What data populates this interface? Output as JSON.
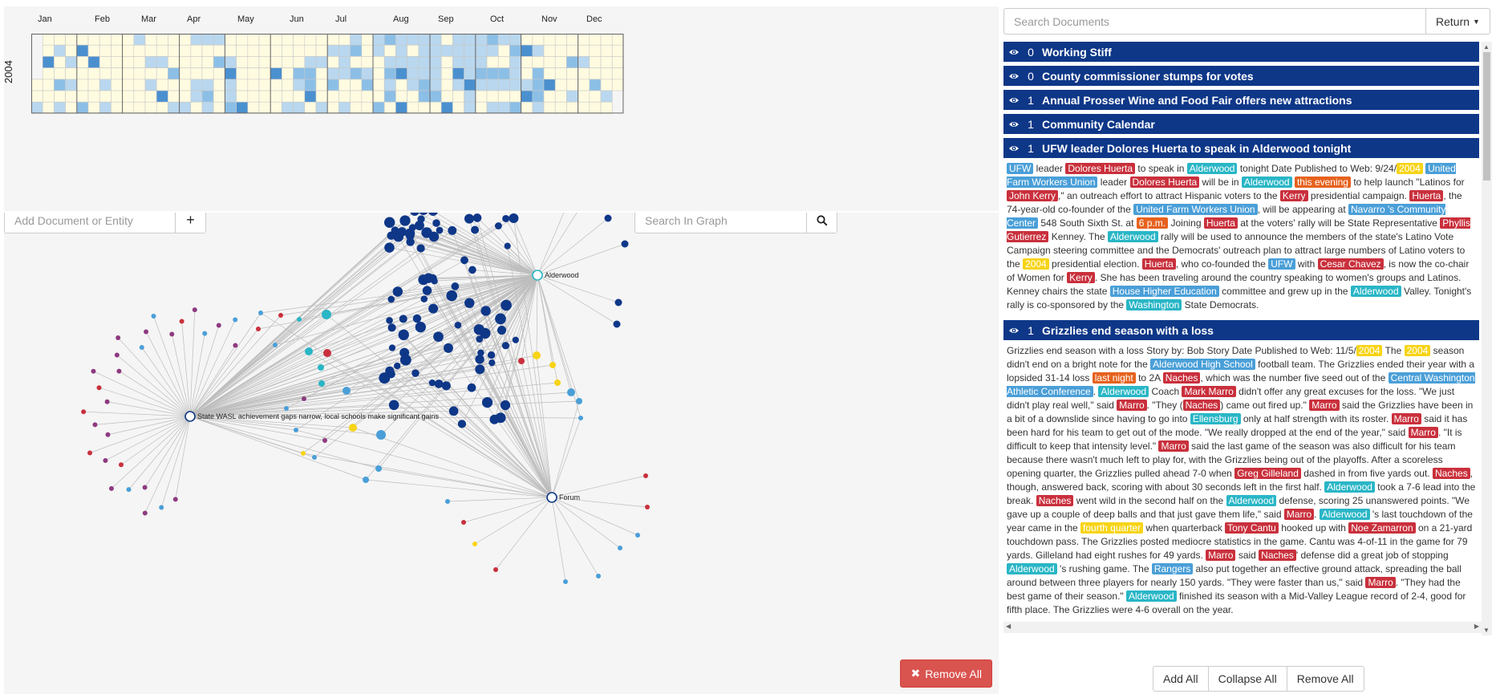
{
  "calendar": {
    "year": "2004",
    "months": [
      "Jan",
      "Feb",
      "Mar",
      "Apr",
      "May",
      "Jun",
      "Jul",
      "Aug",
      "Sep",
      "Oct",
      "Nov",
      "Dec"
    ],
    "colors": {
      "empty": "#fffbe0",
      "light": "#b9d7ee",
      "mid": "#8cbfe6",
      "dark": "#4a90cf"
    }
  },
  "graph": {
    "add_placeholder": "Add Document or Entity",
    "search_placeholder": "Search In Graph",
    "remove_all_label": "Remove All",
    "hub_labels": {
      "alderwood": "Alderwood",
      "forum": "Forum",
      "wasl": "State WASL achievement gaps narrow, local schools make significant gains"
    },
    "colors": {
      "document": "#0e3788",
      "org": "#4a9fd8",
      "per": "#c9303c",
      "loc": "#29b6c6",
      "date": "#f7d417",
      "time": "#e6621e",
      "misc": "#8e3a80",
      "edge": "#bdbdbd"
    }
  },
  "docs": {
    "search_placeholder": "Search Documents",
    "return_label": "Return",
    "items": [
      {
        "count": "0",
        "title": "Working Stiff"
      },
      {
        "count": "0",
        "title": "County commissioner stumps for votes"
      },
      {
        "count": "1",
        "title": "Annual Prosser Wine and Food Fair offers new attractions"
      },
      {
        "count": "1",
        "title": "Community Calendar"
      },
      {
        "count": "1",
        "title": "UFW leader Dolores Huerta to speak in Alderwood tonight"
      },
      {
        "count": "1",
        "title": "Grizzlies end season with a loss"
      }
    ],
    "doc5_body": [
      [
        "org",
        "UFW"
      ],
      [
        "t",
        " leader "
      ],
      [
        "per",
        "Dolores Huerta"
      ],
      [
        "t",
        " to speak in "
      ],
      [
        "loc",
        "Alderwood"
      ],
      [
        "t",
        " tonight Date Published to Web: 9/24/"
      ],
      [
        "date",
        "2004"
      ],
      [
        "t",
        " "
      ],
      [
        "org",
        "United Farm Workers Union"
      ],
      [
        "t",
        " leader "
      ],
      [
        "per",
        "Dolores Huerta"
      ],
      [
        "t",
        " will be in "
      ],
      [
        "loc",
        "Alderwood"
      ],
      [
        "t",
        " "
      ],
      [
        "time",
        "this evening"
      ],
      [
        "t",
        " to help launch \"Latinos for "
      ],
      [
        "per",
        "John Kerry"
      ],
      [
        "t",
        ",\" an outreach effort to attract Hispanic voters to the "
      ],
      [
        "per",
        "Kerry"
      ],
      [
        "t",
        " presidential campaign. "
      ],
      [
        "per",
        "Huerta"
      ],
      [
        "t",
        ", the 74-year-old co-founder of the "
      ],
      [
        "org",
        "United Farm Workers Union"
      ],
      [
        "t",
        ", will be appearing at "
      ],
      [
        "org",
        "Navarro 's Community Center"
      ],
      [
        "t",
        " 548 South Sixth St. at "
      ],
      [
        "time",
        "6 p.m."
      ],
      [
        "t",
        " Joining "
      ],
      [
        "per",
        "Huerta"
      ],
      [
        "t",
        " at the voters' rally will be State Representative "
      ],
      [
        "per",
        "Phyllis Gutierrez"
      ],
      [
        "t",
        " Kenney. The "
      ],
      [
        "loc",
        "Alderwood"
      ],
      [
        "t",
        " rally will be used to announce the members of the state's Latino Vote Campaign steering committee and the Democrats' outreach plan to attract large numbers of Latino voters to the "
      ],
      [
        "date",
        "2004"
      ],
      [
        "t",
        " presidential election. "
      ],
      [
        "per",
        "Huerta"
      ],
      [
        "t",
        ", who co-founded the "
      ],
      [
        "org",
        "UFW"
      ],
      [
        "t",
        " with "
      ],
      [
        "per",
        "Cesar Chavez"
      ],
      [
        "t",
        ", is now the co-chair of Women for "
      ],
      [
        "per",
        "Kerry"
      ],
      [
        "t",
        ". She has been traveling around the country speaking to women's groups and Latinos. Kenney chairs the state "
      ],
      [
        "org",
        "House Higher Education"
      ],
      [
        "t",
        " committee and grew up in the "
      ],
      [
        "loc",
        "Alderwood"
      ],
      [
        "t",
        " Valley. Tonight's rally is co-sponsored by the "
      ],
      [
        "loc",
        "Washington"
      ],
      [
        "t",
        " State Democrats."
      ]
    ],
    "doc6_body": [
      [
        "t",
        "Grizzlies end season with a loss Story by: Bob Story Date Published to Web: 11/5/"
      ],
      [
        "date",
        "2004"
      ],
      [
        "t",
        " The "
      ],
      [
        "date",
        "2004"
      ],
      [
        "t",
        " season didn't end on a bright note for the "
      ],
      [
        "org",
        "Alderwood High School"
      ],
      [
        "t",
        " football team.   The Grizzlies ended their year with a lopsided 31-14 loss "
      ],
      [
        "time",
        "last night"
      ],
      [
        "t",
        " to 2A "
      ],
      [
        "per",
        "Naches"
      ],
      [
        "t",
        ", which was the number five seed out of the "
      ],
      [
        "org",
        "Central Washington Athletic Conference"
      ],
      [
        "t",
        ".   "
      ],
      [
        "loc",
        "Alderwood"
      ],
      [
        "t",
        " Coach "
      ],
      [
        "per",
        "Mark Marro"
      ],
      [
        "t",
        " didn't offer any great excuses for the loss.   \"We just didn't play real well,\" said "
      ],
      [
        "per",
        "Marro"
      ],
      [
        "t",
        ". \"They ("
      ],
      [
        "per",
        "Naches"
      ],
      [
        "t",
        ") came out fired up.\"   "
      ],
      [
        "per",
        "Marro"
      ],
      [
        "t",
        " said the Grizzlies have been in a bit of a downslide since having to go into "
      ],
      [
        "loc",
        "Ellensburg"
      ],
      [
        "t",
        " only at half strength with its roster. "
      ],
      [
        "per",
        "Marro"
      ],
      [
        "t",
        " said it has been hard for his team to get out of the mode.   \"We really dropped at the end of the year,\" said "
      ],
      [
        "per",
        "Marro"
      ],
      [
        "t",
        ". \"It is difficult to keep that intensity level.\"   "
      ],
      [
        "per",
        "Marro"
      ],
      [
        "t",
        " said the last game of the season was also difficult for his team because there wasn't much left to play for, with the Grizzlies being out of the playoffs.   After a scoreless opening quarter, the Grizzlies pulled ahead 7-0 when "
      ],
      [
        "per",
        "Greg Gilleland"
      ],
      [
        "t",
        " dashed in from five yards out. "
      ],
      [
        "per",
        "Naches"
      ],
      [
        "t",
        ", though, answered back, scoring with about 30 seconds left in the first half. "
      ],
      [
        "loc",
        "Alderwood"
      ],
      [
        "t",
        " took a 7-6 lead into the break.   "
      ],
      [
        "per",
        "Naches"
      ],
      [
        "t",
        " went wild in the second half on the "
      ],
      [
        "loc",
        "Alderwood"
      ],
      [
        "t",
        " defense, scoring 25 unanswered points.   \"We gave up a couple of deep balls and that just gave them life,\" said "
      ],
      [
        "per",
        "Marro"
      ],
      [
        "t",
        ".   "
      ],
      [
        "loc",
        "Alderwood"
      ],
      [
        "t",
        " 's last touchdown of the year came in the "
      ],
      [
        "date",
        "fourth quarter"
      ],
      [
        "t",
        " when quarterback "
      ],
      [
        "per",
        "Tony Cantu"
      ],
      [
        "t",
        " hooked up with "
      ],
      [
        "per",
        "Noe Zamarron"
      ],
      [
        "t",
        " on a 21-yard touchdown pass.   The Grizzlies posted mediocre statistics in the game. Cantu was 4-of-11 in the game for 79 yards. Gilleland had eight rushes for 49 yards.   "
      ],
      [
        "per",
        "Marro"
      ],
      [
        "t",
        " said "
      ],
      [
        "per",
        "Naches"
      ],
      [
        "t",
        "' defense did a great job of stopping "
      ],
      [
        "loc",
        "Alderwood"
      ],
      [
        "t",
        " 's rushing game.   The "
      ],
      [
        "org",
        "Rangers"
      ],
      [
        "t",
        " also put together an effective ground attack, spreading the ball around between three players for nearly 150 yards.   \"They were faster than us,\" said "
      ],
      [
        "per",
        "Marro"
      ],
      [
        "t",
        ". \"They had the best game of their season.\"   "
      ],
      [
        "loc",
        "Alderwood"
      ],
      [
        "t",
        " finished its season with a Mid-Valley League record of 2-4, good for fifth place. The Grizzlies were 4-6 overall on the year."
      ]
    ],
    "buttons": {
      "add_all": "Add All",
      "collapse_all": "Collapse All",
      "remove_all": "Remove All"
    }
  }
}
